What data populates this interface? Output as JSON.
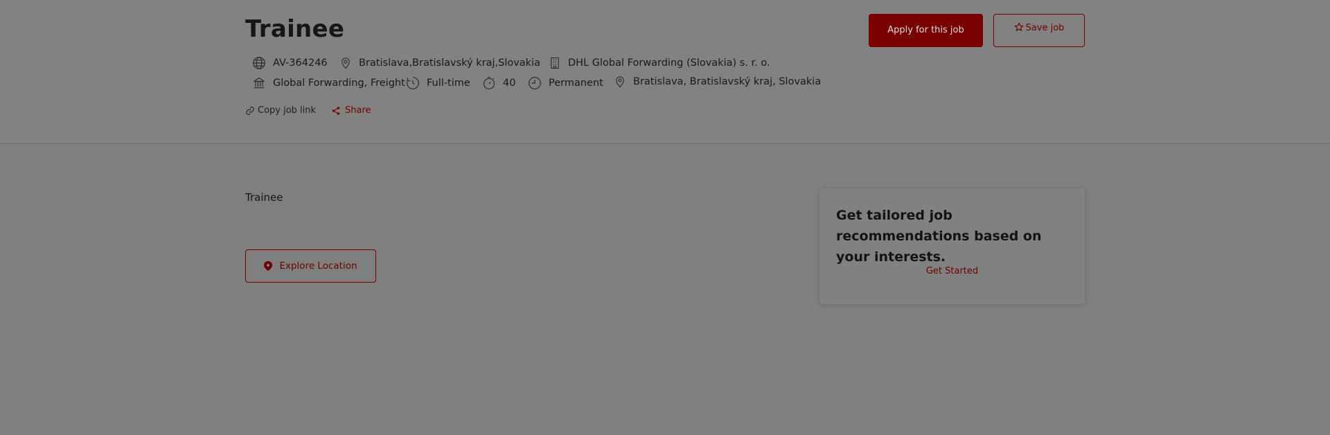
{
  "job": {
    "title": "Trainee",
    "apply_label": "Apply for this job",
    "save_label": "Save job",
    "meta": {
      "id": "AV-364246",
      "location_short": "Bratislava,Bratislavský kraj,Slovakia",
      "company": "DHL Global Forwarding (Slovakia) s. r. o.",
      "division": "Global Forwarding, Freight",
      "schedule": "Full-time",
      "hours": "40",
      "contract": "Permanent",
      "location_full": "Bratislava, Bratislavský kraj, Slovakia"
    },
    "copy_link_label": "Copy job link",
    "share_label": "Share",
    "description": "Trainee",
    "explore_label": "Explore Location"
  },
  "recommendations": {
    "title": "Get tailored job recommendations based on your interests.",
    "cta_label": "Get Started"
  },
  "colors": {
    "brand_red": "#780000",
    "overlay_gray": "#7f7f7f"
  },
  "icons": [
    "globe-icon",
    "location-pin-icon",
    "building-icon",
    "bank-icon",
    "clock-icon",
    "timer-icon",
    "contract-clock-icon",
    "link-icon",
    "share-icon",
    "star-icon",
    "map-marker-icon"
  ]
}
